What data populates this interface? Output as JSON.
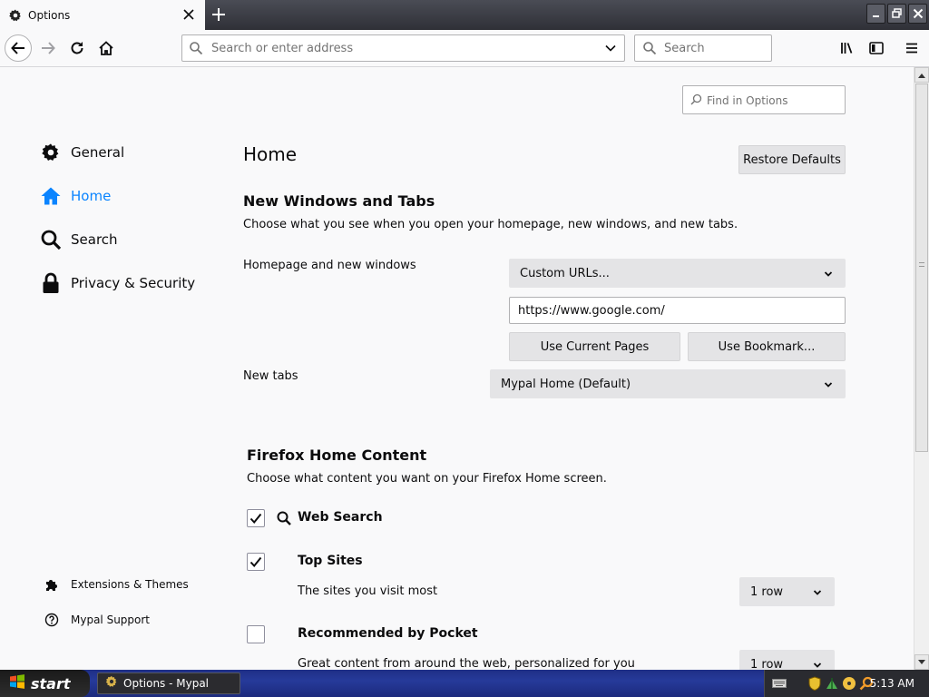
{
  "browser": {
    "tab_title": "Options",
    "url_placeholder": "Search or enter address",
    "search_placeholder": "Search"
  },
  "prefs": {
    "find_placeholder": "Find in Options",
    "categories": [
      {
        "label": "General",
        "icon": "gear-icon"
      },
      {
        "label": "Home",
        "icon": "home-icon"
      },
      {
        "label": "Search",
        "icon": "search-icon"
      },
      {
        "label": "Privacy & Security",
        "icon": "lock-icon"
      }
    ],
    "selected_category": "Home",
    "footer": [
      {
        "label": "Extensions & Themes",
        "icon": "puzzle-icon"
      },
      {
        "label": "Mypal Support",
        "icon": "help-icon"
      }
    ],
    "page_title": "Home",
    "restore_defaults": "Restore Defaults",
    "new_windows": {
      "heading": "New Windows and Tabs",
      "description": "Choose what you see when you open your homepage, new windows, and new tabs.",
      "homepage_label": "Homepage and new windows",
      "homepage_select": "Custom URLs...",
      "homepage_url": "https://www.google.com/",
      "use_current_pages": "Use Current Pages",
      "use_bookmark": "Use Bookmark...",
      "newtabs_label": "New tabs",
      "newtabs_select": "Mypal Home (Default)"
    },
    "home_content": {
      "heading": "Firefox Home Content",
      "description": "Choose what content you want on your Firefox Home screen.",
      "items": [
        {
          "label": "Web Search",
          "checked": true
        },
        {
          "label": "Top Sites",
          "checked": true,
          "sublabel": "The sites you visit most",
          "rows": "1 row"
        },
        {
          "label": "Recommended by Pocket",
          "checked": false,
          "sublabel": "Great content from around the web, personalized for you",
          "rows": "1 row"
        }
      ]
    }
  },
  "taskbar": {
    "start": "start",
    "task_item": "Options - Mypal",
    "clock": "5:13 AM"
  },
  "colors": {
    "accent": "#0a84ff",
    "taskbar": "#263a9a"
  }
}
